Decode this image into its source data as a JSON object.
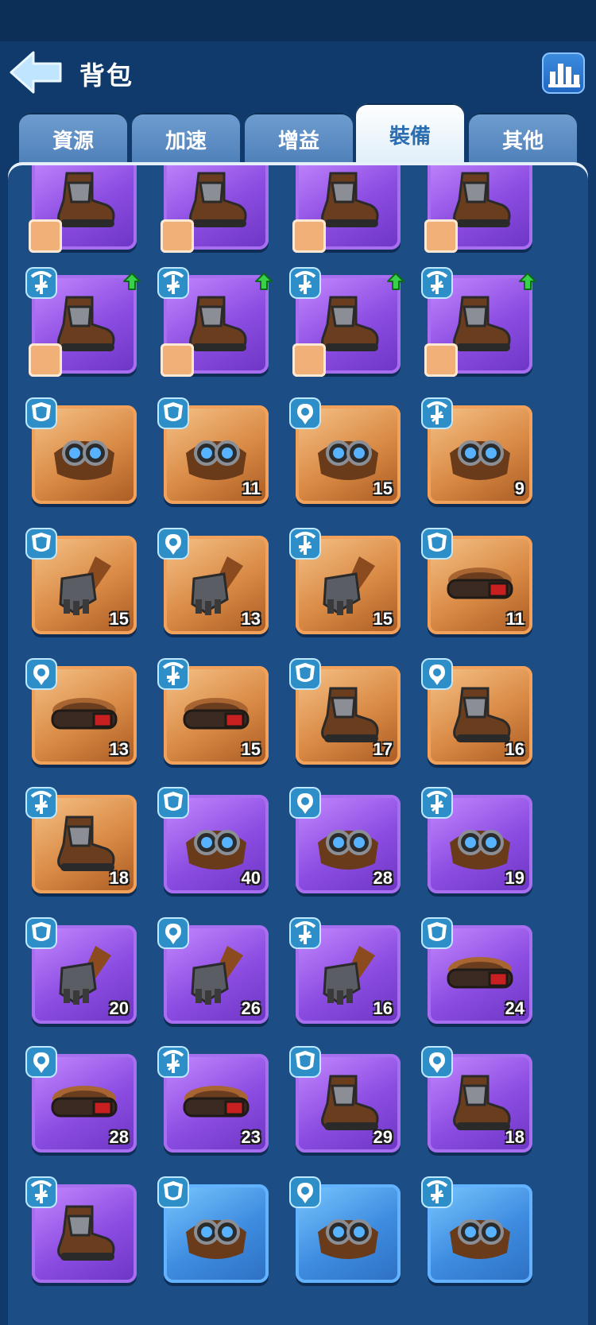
{
  "header": {
    "title": "背包",
    "back_icon": "back-arrow-icon",
    "stats_icon": "bar-chart-icon"
  },
  "tabs": [
    {
      "label": "資源",
      "active": false
    },
    {
      "label": "加速",
      "active": false
    },
    {
      "label": "增益",
      "active": false
    },
    {
      "label": "裝備",
      "active": true
    },
    {
      "label": "其他",
      "active": false
    }
  ],
  "items": [
    {
      "rarity": "purple",
      "type": "none",
      "icon": "boots-icon",
      "count": "",
      "hero": true,
      "upgrade": false
    },
    {
      "rarity": "purple",
      "type": "none",
      "icon": "boots-icon",
      "count": "",
      "hero": true,
      "upgrade": false
    },
    {
      "rarity": "purple",
      "type": "none",
      "icon": "boots-icon",
      "count": "",
      "hero": true,
      "upgrade": false
    },
    {
      "rarity": "purple",
      "type": "none",
      "icon": "boots-icon",
      "count": "",
      "hero": true,
      "upgrade": false
    },
    {
      "rarity": "purple",
      "type": "crossbow",
      "icon": "boots-icon",
      "count": "",
      "hero": true,
      "upgrade": true
    },
    {
      "rarity": "purple",
      "type": "crossbow",
      "icon": "boots-icon",
      "count": "",
      "hero": true,
      "upgrade": true
    },
    {
      "rarity": "purple",
      "type": "crossbow",
      "icon": "boots-icon",
      "count": "",
      "hero": true,
      "upgrade": true
    },
    {
      "rarity": "purple",
      "type": "crossbow",
      "icon": "boots-icon",
      "count": "",
      "hero": true,
      "upgrade": true
    },
    {
      "rarity": "orange",
      "type": "shield",
      "icon": "goggles-icon",
      "count": "",
      "hero": false,
      "upgrade": false
    },
    {
      "rarity": "orange",
      "type": "shield",
      "icon": "goggles-icon",
      "count": "11",
      "hero": false,
      "upgrade": false
    },
    {
      "rarity": "orange",
      "type": "pin",
      "icon": "goggles-icon",
      "count": "15",
      "hero": false,
      "upgrade": false
    },
    {
      "rarity": "orange",
      "type": "crossbow",
      "icon": "goggles-icon",
      "count": "9",
      "hero": false,
      "upgrade": false
    },
    {
      "rarity": "orange",
      "type": "shield",
      "icon": "gauntlet-icon",
      "count": "15",
      "hero": false,
      "upgrade": false
    },
    {
      "rarity": "orange",
      "type": "pin",
      "icon": "gauntlet-icon",
      "count": "13",
      "hero": false,
      "upgrade": false
    },
    {
      "rarity": "orange",
      "type": "crossbow",
      "icon": "gauntlet-icon",
      "count": "15",
      "hero": false,
      "upgrade": false
    },
    {
      "rarity": "orange",
      "type": "shield",
      "icon": "belt-icon",
      "count": "11",
      "hero": false,
      "upgrade": false
    },
    {
      "rarity": "orange",
      "type": "pin",
      "icon": "belt-icon",
      "count": "13",
      "hero": false,
      "upgrade": false
    },
    {
      "rarity": "orange",
      "type": "crossbow",
      "icon": "belt-icon",
      "count": "15",
      "hero": false,
      "upgrade": false
    },
    {
      "rarity": "orange",
      "type": "shield",
      "icon": "boots-icon",
      "count": "17",
      "hero": false,
      "upgrade": false
    },
    {
      "rarity": "orange",
      "type": "pin",
      "icon": "boots-icon",
      "count": "16",
      "hero": false,
      "upgrade": false
    },
    {
      "rarity": "orange",
      "type": "crossbow",
      "icon": "boots-icon",
      "count": "18",
      "hero": false,
      "upgrade": false
    },
    {
      "rarity": "purple",
      "type": "shield",
      "icon": "goggles-icon",
      "count": "40",
      "hero": false,
      "upgrade": false
    },
    {
      "rarity": "purple",
      "type": "pin",
      "icon": "goggles-icon",
      "count": "28",
      "hero": false,
      "upgrade": false
    },
    {
      "rarity": "purple",
      "type": "crossbow",
      "icon": "goggles-icon",
      "count": "19",
      "hero": false,
      "upgrade": false
    },
    {
      "rarity": "purple",
      "type": "shield",
      "icon": "gauntlet-icon",
      "count": "20",
      "hero": false,
      "upgrade": false
    },
    {
      "rarity": "purple",
      "type": "pin",
      "icon": "gauntlet-icon",
      "count": "26",
      "hero": false,
      "upgrade": false
    },
    {
      "rarity": "purple",
      "type": "crossbow",
      "icon": "gauntlet-icon",
      "count": "16",
      "hero": false,
      "upgrade": false
    },
    {
      "rarity": "purple",
      "type": "shield",
      "icon": "belt-icon",
      "count": "24",
      "hero": false,
      "upgrade": false
    },
    {
      "rarity": "purple",
      "type": "pin",
      "icon": "belt-icon",
      "count": "28",
      "hero": false,
      "upgrade": false
    },
    {
      "rarity": "purple",
      "type": "crossbow",
      "icon": "belt-icon",
      "count": "23",
      "hero": false,
      "upgrade": false
    },
    {
      "rarity": "purple",
      "type": "shield",
      "icon": "boots-icon",
      "count": "29",
      "hero": false,
      "upgrade": false
    },
    {
      "rarity": "purple",
      "type": "pin",
      "icon": "boots-icon",
      "count": "18",
      "hero": false,
      "upgrade": false
    },
    {
      "rarity": "purple",
      "type": "crossbow",
      "icon": "boots-icon",
      "count": "",
      "hero": false,
      "upgrade": false
    },
    {
      "rarity": "blue",
      "type": "shield",
      "icon": "goggles-icon",
      "count": "",
      "hero": false,
      "upgrade": false
    },
    {
      "rarity": "blue",
      "type": "pin",
      "icon": "goggles-icon",
      "count": "",
      "hero": false,
      "upgrade": false
    },
    {
      "rarity": "blue",
      "type": "crossbow",
      "icon": "goggles-icon",
      "count": "",
      "hero": false,
      "upgrade": false
    }
  ]
}
